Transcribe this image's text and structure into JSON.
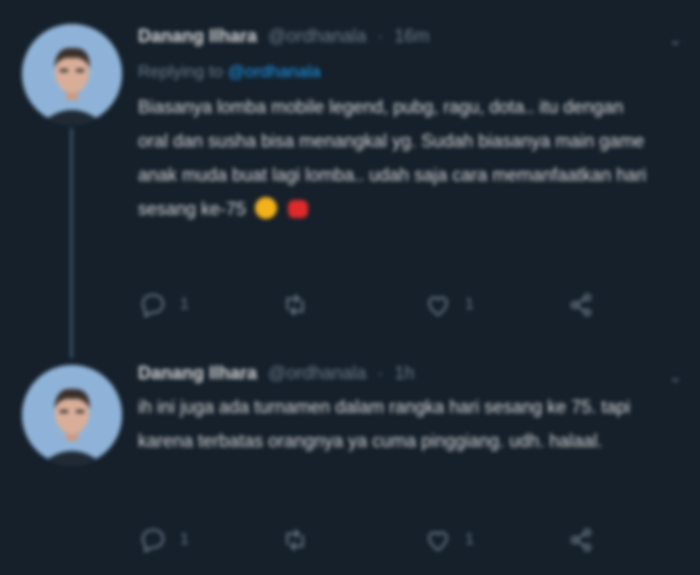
{
  "tweets": [
    {
      "name": "Danang Ilhara",
      "handle": "@ordhanala",
      "time": "16m",
      "replying_prefix": "Replying to",
      "replying_to": "@ordhanala",
      "text": "Biasanya lomba mobile legend, pubg, ragu, dota.. itu dengan oral dan susha bisa menangkal yg. Sudah biasanya main game anak muda buat lagi lomba.. udah saja cara memanfaatkan hari sesang ke-75",
      "actions": {
        "reply": "1",
        "retweet": "",
        "like": "1",
        "share": ""
      }
    },
    {
      "name": "Danang Ilhara",
      "handle": "@ordhanala",
      "time": "1h",
      "text": "ih ini juga ada turnamen dalam rangka hari sesang ke 75. tapi karena terbatas orangnya ya cuma pinggiang. udh. halaal.",
      "actions": {
        "reply": "1",
        "retweet": "",
        "like": "1",
        "share": ""
      }
    }
  ],
  "icons": {
    "reply": "reply-icon",
    "retweet": "retweet-icon",
    "like": "like-icon",
    "share": "share-icon",
    "more": "chevron-down-icon"
  },
  "colors": {
    "background": "#15202b",
    "accent": "#1d9bf0",
    "muted": "#6e7e8c",
    "text": "#d9d9d9"
  }
}
